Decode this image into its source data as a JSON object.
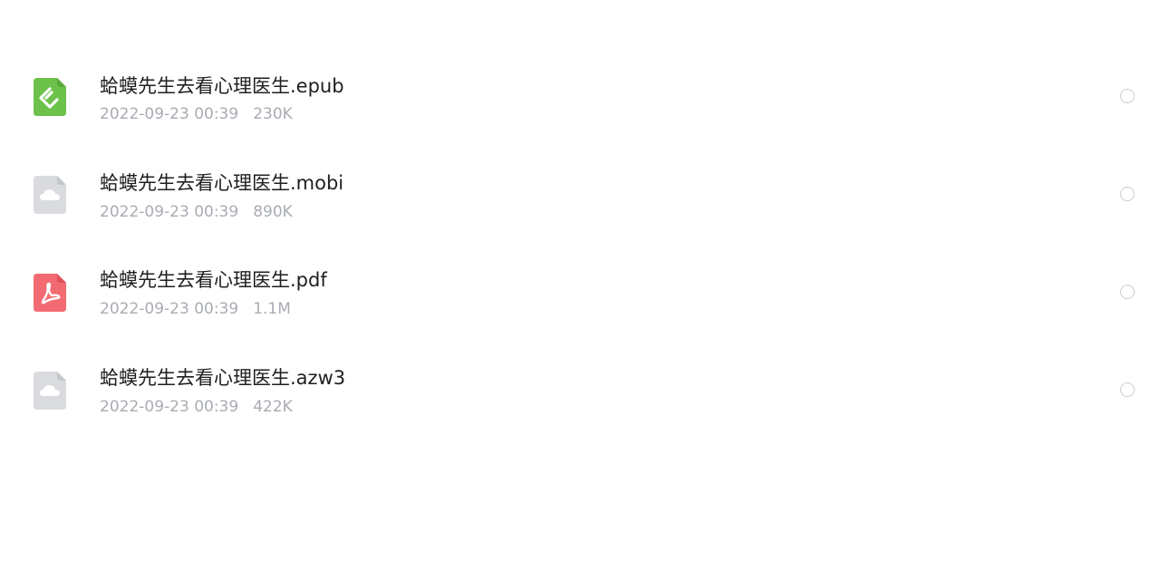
{
  "files": [
    {
      "name": "蛤蟆先生去看心理医生.epub",
      "date": "2022-09-23 00:39",
      "size": "230K",
      "icon": "epub-file-icon",
      "icon_color": "#6cc24a"
    },
    {
      "name": "蛤蟆先生去看心理医生.mobi",
      "date": "2022-09-23 00:39",
      "size": "890K",
      "icon": "cloud-file-icon",
      "icon_color": "#d9dbdf"
    },
    {
      "name": "蛤蟆先生去看心理医生.pdf",
      "date": "2022-09-23 00:39",
      "size": "1.1M",
      "icon": "pdf-file-icon",
      "icon_color": "#f36b72"
    },
    {
      "name": "蛤蟆先生去看心理医生.azw3",
      "date": "2022-09-23 00:39",
      "size": "422K",
      "icon": "cloud-file-icon",
      "icon_color": "#d9dbdf"
    }
  ]
}
